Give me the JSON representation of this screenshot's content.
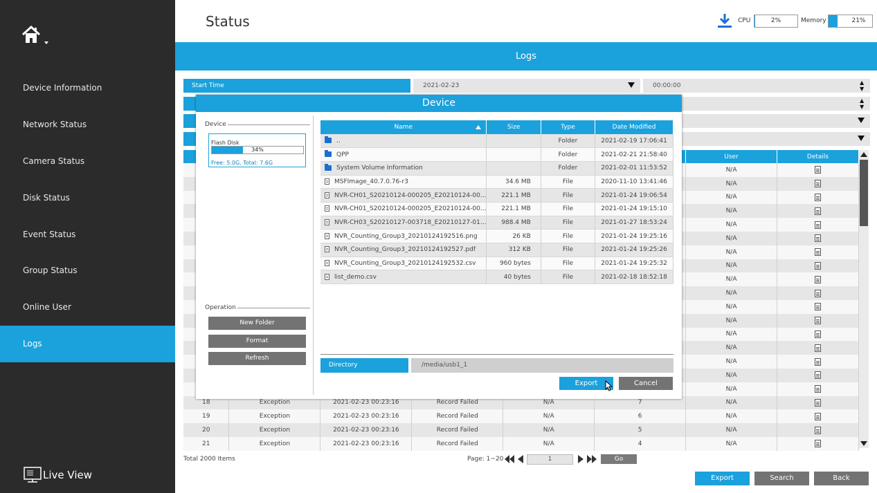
{
  "sidebar": {
    "items": [
      {
        "label": "Device Information"
      },
      {
        "label": "Network Status"
      },
      {
        "label": "Camera Status"
      },
      {
        "label": "Disk Status"
      },
      {
        "label": "Event Status"
      },
      {
        "label": "Group Status"
      },
      {
        "label": "Online User"
      },
      {
        "label": "Logs"
      }
    ],
    "live_view": "Live View"
  },
  "header": {
    "title": "Status",
    "cpu_label": "CPU",
    "cpu_value": "2%",
    "cpu_fraction": 0.02,
    "memory_label": "Memory",
    "memory_value": "21%",
    "memory_fraction": 0.21
  },
  "banner": "Logs",
  "filter": {
    "start_time_label": "Start Time",
    "start_date": "2021-02-23",
    "start_time": "00:00:00"
  },
  "log_table": {
    "headers": [
      "",
      "",
      "",
      "",
      "",
      "",
      "User",
      "Details"
    ],
    "visible_rows": [
      {
        "user": "N/A"
      },
      {
        "user": "N/A"
      },
      {
        "user": "N/A"
      },
      {
        "user": "N/A"
      },
      {
        "user": "N/A"
      },
      {
        "user": "N/A"
      },
      {
        "user": "N/A"
      },
      {
        "user": "N/A"
      },
      {
        "user": "N/A"
      },
      {
        "user": "N/A"
      },
      {
        "user": "N/A"
      },
      {
        "user": "N/A"
      },
      {
        "user": "N/A"
      },
      {
        "user": "N/A"
      },
      {
        "user": "N/A"
      },
      {
        "user": "N/A"
      },
      {
        "user": "N/A"
      },
      {
        "no": "18",
        "type": "Exception",
        "time": "2021-02-23 00:23:16",
        "event": "Record Failed",
        "param": "N/A",
        "ch": "7",
        "user": "N/A"
      },
      {
        "no": "19",
        "type": "Exception",
        "time": "2021-02-23 00:23:16",
        "event": "Record Failed",
        "param": "N/A",
        "ch": "6",
        "user": "N/A"
      },
      {
        "no": "20",
        "type": "Exception",
        "time": "2021-02-23 00:23:16",
        "event": "Record Failed",
        "param": "N/A",
        "ch": "5",
        "user": "N/A"
      },
      {
        "no": "21",
        "type": "Exception",
        "time": "2021-02-23 00:23:16",
        "event": "Record Failed",
        "param": "N/A",
        "ch": "4",
        "user": "N/A"
      }
    ]
  },
  "footer": {
    "total": "Total 2000 Items",
    "page_label": "Page: 1~20",
    "page_value": "1",
    "go": "Go",
    "export": "Export",
    "search": "Search",
    "back": "Back"
  },
  "modal": {
    "title": "Device",
    "device_group": "Device",
    "disk": {
      "name": "Flash Disk",
      "percent": "34%",
      "fraction": 0.34,
      "free_total": "Free: 5.0G, Total: 7.6G"
    },
    "operation_group": "Operation",
    "buttons": {
      "new_folder": "New Folder",
      "format": "Format",
      "refresh": "Refresh",
      "export": "Export",
      "cancel": "Cancel"
    },
    "file_table": {
      "headers": {
        "name": "Name",
        "size": "Size",
        "type": "Type",
        "date": "Date Modified"
      },
      "rows": [
        {
          "icon": "folder-icon",
          "name": "..",
          "size": "",
          "type": "Folder",
          "date": "2021-02-19 17:06:41"
        },
        {
          "icon": "folder-icon",
          "name": "QPP",
          "size": "",
          "type": "Folder",
          "date": "2021-02-21 21:58:40"
        },
        {
          "icon": "folder-icon",
          "name": "System Volume Information",
          "size": "",
          "type": "Folder",
          "date": "2021-02-01 11:53:52"
        },
        {
          "icon": "file-icon",
          "name": "MSFImage_40.7.0.76-r3",
          "size": "34.6 MB",
          "type": "File",
          "date": "2020-11-10 13:41:46"
        },
        {
          "icon": "file-icon",
          "name": "NVR-CH01_S20210124-000205_E20210124-00...",
          "size": "221.1 MB",
          "type": "File",
          "date": "2021-01-24 19:06:54"
        },
        {
          "icon": "file-icon",
          "name": "NVR-CH01_S20210124-000205_E20210124-00...",
          "size": "221.1 MB",
          "type": "File",
          "date": "2021-01-24 19:15:10"
        },
        {
          "icon": "file-icon",
          "name": "NVR-CH03_S20210127-003718_E20210127-01...",
          "size": "988.4 MB",
          "type": "File",
          "date": "2021-01-27 18:53:24"
        },
        {
          "icon": "file-icon",
          "name": "NVR_Counting_Group3_20210124192516.png",
          "size": "26 KB",
          "type": "File",
          "date": "2021-01-24 19:25:16"
        },
        {
          "icon": "file-icon",
          "name": "NVR_Counting_Group3_20210124192527.pdf",
          "size": "312 KB",
          "type": "File",
          "date": "2021-01-24 19:25:26"
        },
        {
          "icon": "file-icon",
          "name": "NVR_Counting_Group3_20210124192532.csv",
          "size": "960 bytes",
          "type": "File",
          "date": "2021-01-24 19:25:32"
        },
        {
          "icon": "file-icon",
          "name": "list_demo.csv",
          "size": "40 bytes",
          "type": "File",
          "date": "2021-02-18 18:52:18"
        }
      ]
    },
    "directory_label": "Directory",
    "directory_value": "/media/usb1_1"
  },
  "colors": {
    "accent": "#1ba1dc",
    "sidebar_bg": "#2b2b2b",
    "button_gray": "#737373"
  }
}
